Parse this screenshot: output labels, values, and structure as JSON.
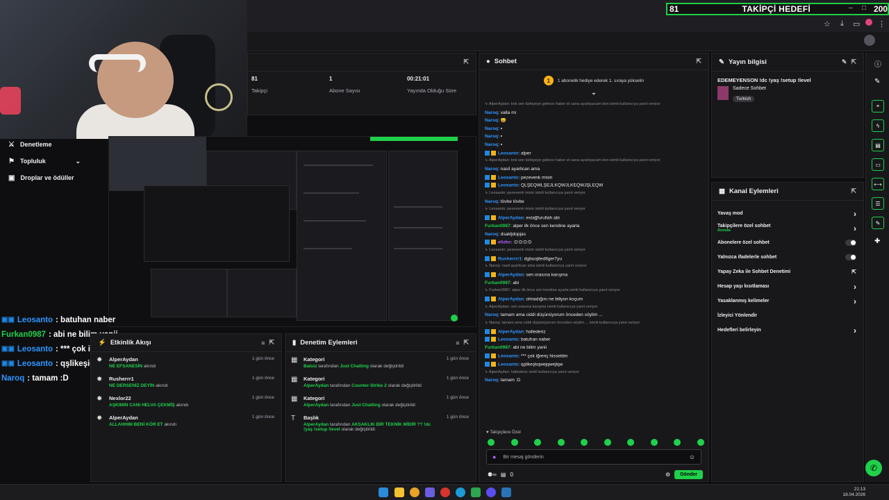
{
  "goal": {
    "current": "81",
    "label": "TAKİPÇİ HEDEFİ",
    "target": "200"
  },
  "left_nav": [
    {
      "icon": "moderation-icon",
      "label": "Denetleme"
    },
    {
      "icon": "community-icon",
      "label": "Topluluk"
    },
    {
      "icon": "drops-icon",
      "label": "Droplar ve ödüller"
    }
  ],
  "overlay_chat": [
    {
      "user": "Leosanto",
      "text": ": batuhan naber",
      "color": "#2e96ff",
      "badges": true
    },
    {
      "user": "Furkan0987",
      "text": ": abi ne bilim yanii",
      "color": "#1fd14a",
      "badges": false
    },
    {
      "user": "Leosanto",
      "text": ": *** çok iğrenç hissettim",
      "color": "#2e96ff",
      "badges": true
    },
    {
      "user": "Leosanto",
      "text": ": qşlikeşiqwejqwejiqw",
      "color": "#2e96ff",
      "badges": true
    },
    {
      "user": "Naroq",
      "text": ": tamam :D",
      "color": "#2e96ff",
      "badges": false
    }
  ],
  "stats": [
    {
      "value": "81",
      "label": "Takipçi"
    },
    {
      "value": "1",
      "label": "Abone Sayısı"
    },
    {
      "value": "00:21:01",
      "label": "Yayında Olduğu Süre"
    }
  ],
  "activity": {
    "title": "Etkinlik Akışı",
    "items": [
      {
        "user": "AlperAydan",
        "msg": "NE EFSANESİN",
        "tail": "akındı",
        "time": "1 gün önce"
      },
      {
        "user": "Rusherrr1",
        "msg": "NE DERSENİZ DEYİN",
        "tail": "akındı",
        "time": "1 gün önce"
      },
      {
        "user": "Nexlor22",
        "msg": "AŞKIMIN CANI HELVA ÇEKMİŞ",
        "tail": "akındı",
        "time": "1 gün önce"
      },
      {
        "user": "AlperAydan",
        "msg": "ALLAHHIM BENİ KÖR ET",
        "tail": "akındı",
        "time": "1 gün önce"
      }
    ]
  },
  "modactions": {
    "title": "Denetim Eylemleri",
    "items": [
      {
        "type": "Kategori",
        "who": "Batuiz",
        "mid": " tarafından ",
        "what": "Just Chatting",
        "tail": " olarak değiştirildi",
        "time": "1 gün önce"
      },
      {
        "type": "Kategori",
        "who": "AlperAydan",
        "mid": " tarafından ",
        "what": "Counter-Strike 2",
        "tail": " olarak değiştirildi",
        "time": "1 gün önce"
      },
      {
        "type": "Kategori",
        "who": "AlperAydan",
        "mid": " tarafından ",
        "what": "Just Chatting",
        "tail": " olarak değiştirildi",
        "time": "1 gün önce"
      },
      {
        "type": "Başlık",
        "who": "AlperAydan",
        "mid": " tarafından ",
        "what": "AKSAKLIK BİR TEKNİK MİDİR ?? !dc !yaş !setup !level",
        "tail": " olarak değiştirildi",
        "time": "1 gün önce"
      }
    ]
  },
  "chat": {
    "title": "Sohbet",
    "pinned": "1 abonelik hediye ederek 1. sıraya yükselin",
    "lines": [
      {
        "kind": "reply",
        "text": "↳ AlperAydan: knk sen türkiyeye gelince haber et sana ayarlıyacam ben isimli kullanıcıya yanıt veriyor"
      },
      {
        "kind": "msg",
        "user": "Naroq",
        "color": "blue",
        "text": "valla mi"
      },
      {
        "kind": "msg",
        "user": "Naroq",
        "color": "blue",
        "text": "😄"
      },
      {
        "kind": "msg",
        "user": "Naroq",
        "color": "blue",
        "text": "▪"
      },
      {
        "kind": "msg",
        "user": "Naroq",
        "color": "blue",
        "text": "▪"
      },
      {
        "kind": "msg",
        "user": "Naroq",
        "color": "blue",
        "text": "▪"
      },
      {
        "kind": "msg",
        "user": "Leosanto",
        "color": "blue",
        "badges": true,
        "text": "alper"
      },
      {
        "kind": "reply",
        "text": "↳ AlperAydan: knk sen türkiyeye gelince haber et sana ayarlıyacam ben isimli kullanıcıya yanıt veriyor"
      },
      {
        "kind": "msg",
        "user": "Naroq",
        "color": "blue",
        "text": "nasil ayarlican ama"
      },
      {
        "kind": "msg",
        "user": "Leosanto",
        "color": "blue",
        "badges": true,
        "text": "pezevenk misin"
      },
      {
        "kind": "msg",
        "user": "Leosanto",
        "color": "blue",
        "badges": true,
        "text": "QLŞEQWLŞEJLKQWJLKEQWJŞLEQW"
      },
      {
        "kind": "reply",
        "text": "↳ Leosanto: pezevenk misin isimli kullanıcıya yanıt veriyor"
      },
      {
        "kind": "msg",
        "user": "Naroq",
        "color": "blue",
        "text": "tövbe tövbe"
      },
      {
        "kind": "reply",
        "text": "↳ Leosanto: pezevenk misin isimli kullanıcıya yanıt veriyor"
      },
      {
        "kind": "msg",
        "user": "AlperAydan",
        "color": "blue",
        "badges": true,
        "text": "estağfurullah abi"
      },
      {
        "kind": "msg",
        "user": "Furkan0987",
        "color": "green",
        "text": "alper ilk önce sen kendine ayarla"
      },
      {
        "kind": "msg",
        "user": "Naroq",
        "color": "blue",
        "text": "dsakljdopjas"
      },
      {
        "kind": "msg",
        "user": "elizko",
        "color": "purple",
        "badges": true,
        "text": ":D:D:D:D"
      },
      {
        "kind": "reply",
        "text": "↳ Leosanto: pezevenk misin isimli kullanıcıya yanıt veriyor"
      },
      {
        "kind": "msg",
        "user": "Rusherrrr1",
        "color": "blue",
        "badges": true,
        "text": "dgbuojited8ger7yu"
      },
      {
        "kind": "reply",
        "text": "↳ Naroq: nasil ayarlican ama isimli kullanıcıya yanıt veriyor"
      },
      {
        "kind": "msg",
        "user": "AlperAydan",
        "color": "blue",
        "badges": true,
        "text": "sen orasına karışma"
      },
      {
        "kind": "msg",
        "user": "Furkan0987",
        "color": "green",
        "text": "abi"
      },
      {
        "kind": "reply",
        "text": "↳ Furkan0987: alper ilk önce sen kendine ayarla isimli kullanıcıya yanıt veriyor"
      },
      {
        "kind": "msg",
        "user": "AlperAydan",
        "color": "blue",
        "badges": true,
        "text": "olmadığını ne biliyon koçum"
      },
      {
        "kind": "reply",
        "text": "↳ AlperAydan: sen orasına karışma isimli kullanıcıya yanıt veriyor"
      },
      {
        "kind": "msg",
        "user": "Naroq",
        "color": "blue",
        "text": "tamam ama ciddi düşünüyorum önceden söylim ..."
      },
      {
        "kind": "reply",
        "text": "↳ Naroq: tamam ama ciddi düşünüyorum önceden söylim ... isimli kullanıcıya yanıt veriyor"
      },
      {
        "kind": "msg",
        "user": "AlperAydan",
        "color": "blue",
        "badges": true,
        "text": "hallederiz"
      },
      {
        "kind": "msg",
        "user": "Leosanto",
        "color": "blue",
        "badges": true,
        "text": "batuhan naber"
      },
      {
        "kind": "msg",
        "user": "Furkan0987",
        "color": "green",
        "text": "abi ne bilim yanii"
      },
      {
        "kind": "msg",
        "user": "Leosanto",
        "color": "blue",
        "badges": true,
        "text": "*** çok iğrenç hissettim"
      },
      {
        "kind": "msg",
        "user": "Leosanto",
        "color": "blue",
        "badges": true,
        "text": "qşlikeşkqwejqwejlqw"
      },
      {
        "kind": "reply",
        "text": "↳ AlperAydan: hallederiz isimli kullanıcıya yanıt veriyor"
      },
      {
        "kind": "msg",
        "user": "Naroq",
        "color": "blue",
        "text": "tamam :D"
      }
    ],
    "subs_only": "♥ Takipçilere Özel",
    "input_placeholder": "Bir mesaj gönderin",
    "bottom_count": "0",
    "send_label": "Gönder"
  },
  "stream_info": {
    "title": "Yayın bilgisi",
    "stream_title": "EDEMEYENSON !dc !yaş !setup !level",
    "category": "Sadece Sohbet",
    "tag": "Turkish"
  },
  "channel_actions": {
    "title": "Kanal Eylemleri",
    "items": [
      {
        "label": "Yavaş mod",
        "sub": "",
        "control": "chevron"
      },
      {
        "label": "Takipçilere özel sohbet",
        "sub": "Anında",
        "control": "chevron"
      },
      {
        "label": "Abonelere özel sohbet",
        "sub": "",
        "control": "toggle"
      },
      {
        "label": "Yalnızca ifadelerle sohbet",
        "sub": "",
        "control": "toggle"
      },
      {
        "label": "Yapay Zeka ile Sohbet Denetimi",
        "sub": "",
        "control": "external"
      },
      {
        "label": "Hesap yaşı kısıtlaması",
        "sub": "",
        "control": "chevron"
      },
      {
        "label": "Yasaklanmış kelimeler",
        "sub": "",
        "control": "chevron"
      },
      {
        "label": "İzleyici Yönlendir",
        "sub": "",
        "control": "none"
      },
      {
        "label": "Hedefleri belirleyin",
        "sub": "",
        "control": "chevron"
      }
    ]
  },
  "clock": {
    "time": "21:13",
    "date": "18.04.2026"
  },
  "colors": {
    "accent": "#1fd14a",
    "bg": "#0e0e10",
    "panel": "#18181b",
    "link": "#2e96ff"
  }
}
